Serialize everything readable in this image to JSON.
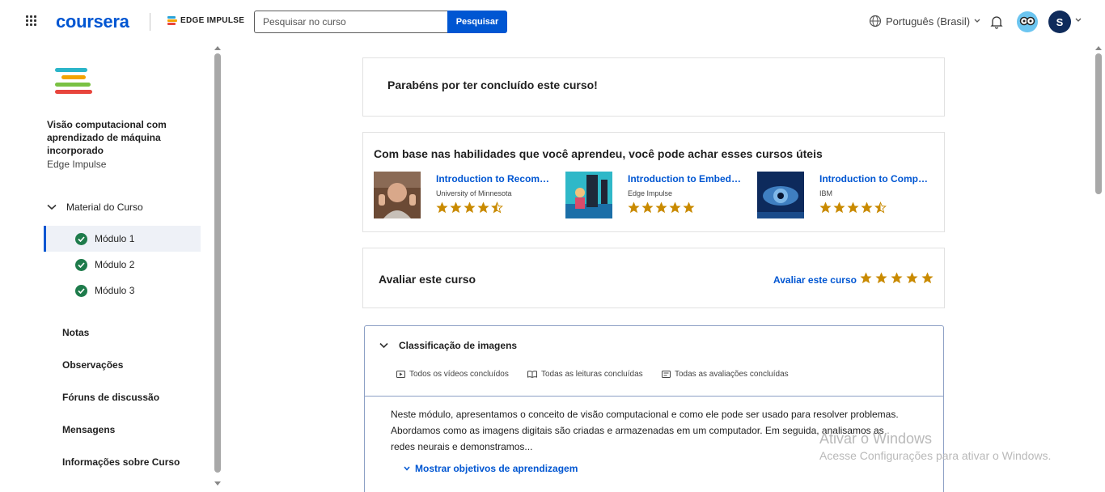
{
  "header": {
    "logo": "coursera",
    "partner_logo": "EDGE IMPULSE",
    "search_placeholder": "Pesquisar no curso",
    "search_button": "Pesquisar",
    "language": "Português (Brasil)",
    "avatar_initial": "S"
  },
  "sidebar": {
    "course_title": "Visão computacional com aprendizado de máquina incorporado",
    "course_partner": "Edge Impulse",
    "material_label": "Material do Curso",
    "modules": [
      "Módulo 1",
      "Módulo 2",
      "Módulo 3"
    ],
    "links": [
      "Notas",
      "Observações",
      "Fóruns de discussão",
      "Mensagens",
      "Informações sobre Curso"
    ]
  },
  "main": {
    "congrats": "Parabéns por ter concluído este curso!",
    "recs_title": "Com base nas habilidades que você aprendeu, você pode achar esses cursos úteis",
    "recommendations": [
      {
        "title": "Introduction to Recom…",
        "partner": "University of Minnesota",
        "rating": 4.5
      },
      {
        "title": "Introduction to Embed…",
        "partner": "Edge Impulse",
        "rating": 5
      },
      {
        "title": "Introduction to Compu…",
        "partner": "IBM",
        "rating": 4.5
      }
    ],
    "rate_title": "Avaliar este curso",
    "rate_link": "Avaliar este curso",
    "module_card": {
      "title": "Classificação de imagens",
      "status_videos": "Todos os vídeos concluídos",
      "status_readings": "Todas as leituras concluídas",
      "status_assessments": "Todas as avaliações concluídas",
      "description": "Neste módulo, apresentamos o conceito de visão computacional e como ele pode ser usado para resolver problemas. Abordamos como as imagens digitais são criadas e armazenadas em um computador. Em seguida, analisamos as redes neurais e demonstramos...",
      "objectives_link": "Mostrar objetivos de aprendizagem"
    }
  },
  "watermark": {
    "title": "Ativar o Windows",
    "subtitle": "Acesse Configurações para ativar o Windows."
  },
  "colors": {
    "brand": "#0056d2",
    "check": "#1e7b4b",
    "star": "#c98a00"
  }
}
